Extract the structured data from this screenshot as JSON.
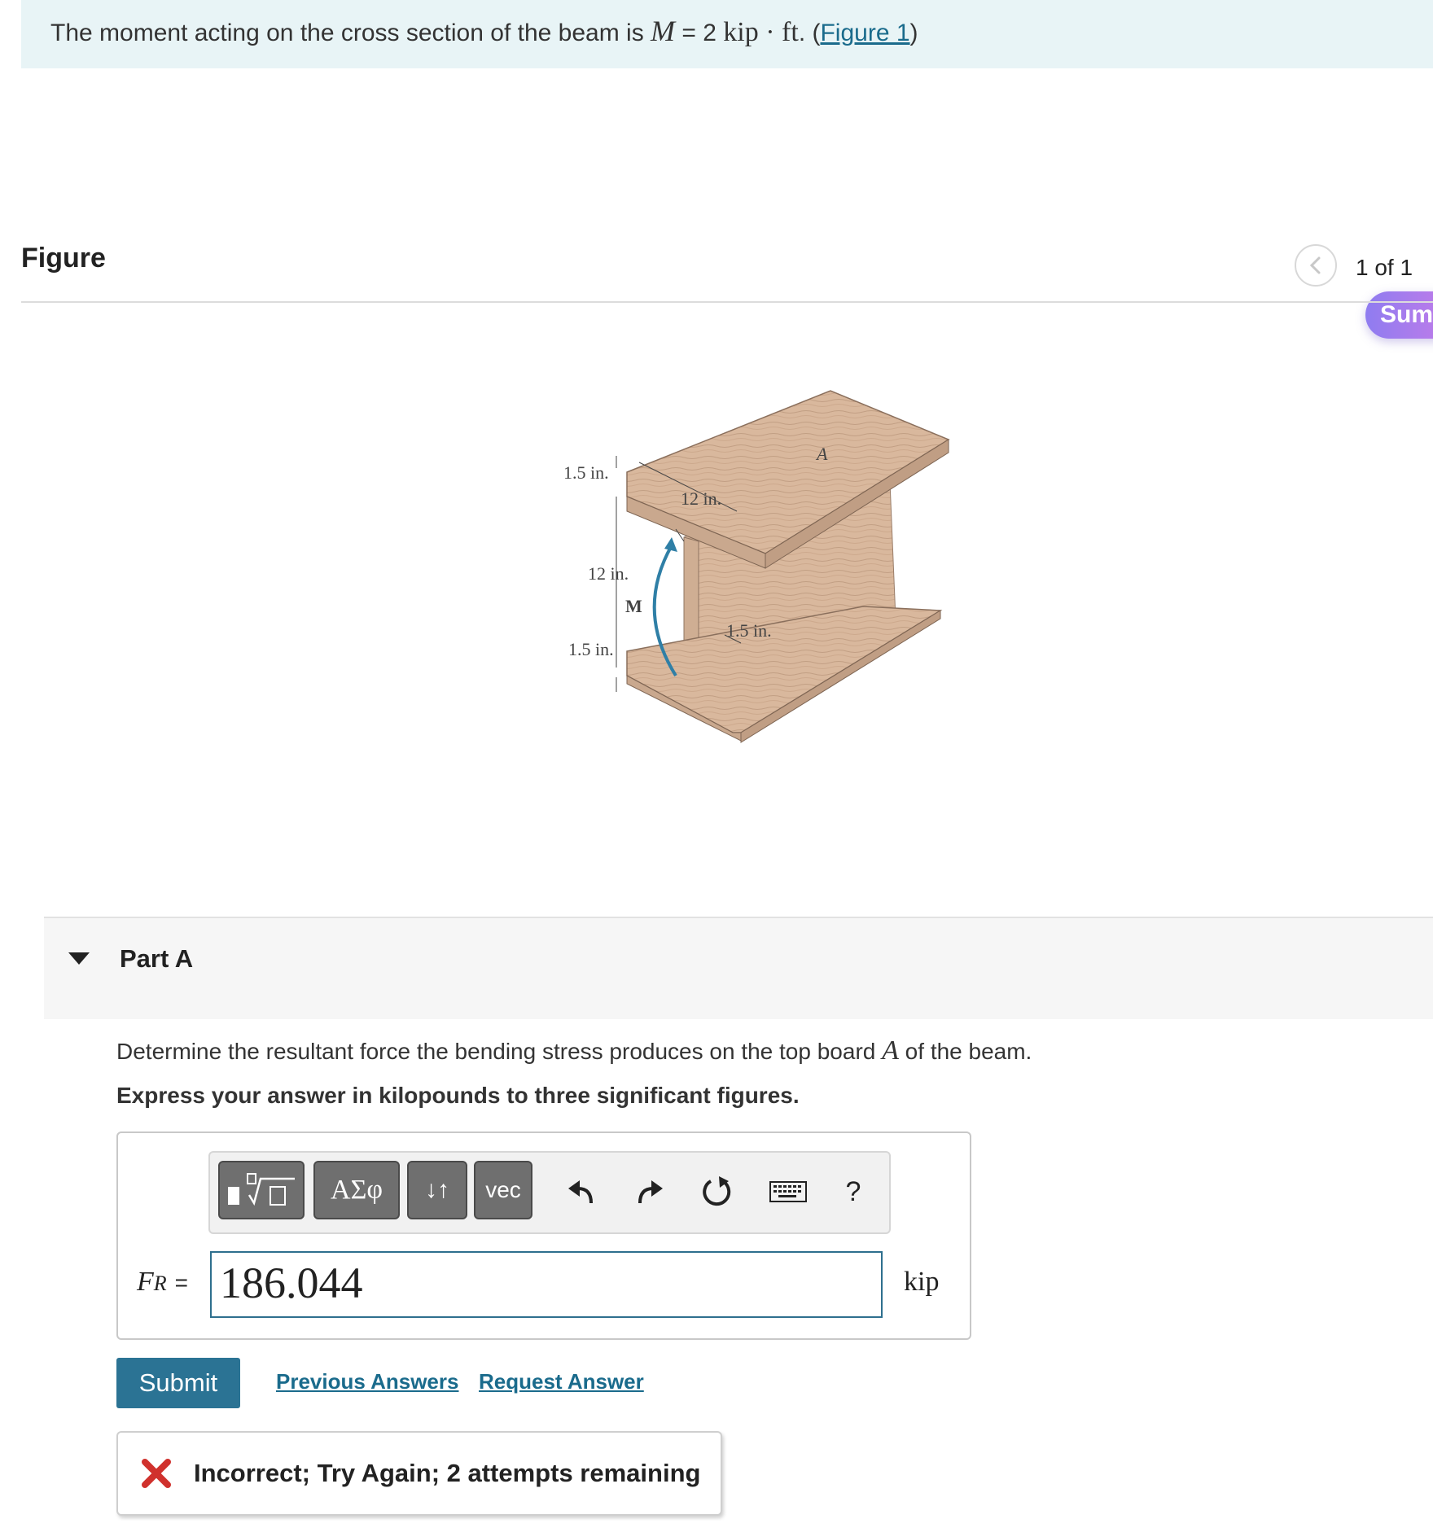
{
  "problem": {
    "text_before": "The moment acting on the cross section of the beam is ",
    "symbol": "M",
    "equals": " = 2 ",
    "unit": "kip · ft",
    "after_unit": ". (",
    "figure_link": "Figure 1",
    "close": ")"
  },
  "figure_panel": {
    "title": "Figure",
    "count": "1 of 1",
    "summary_pill": "Sum",
    "labels": {
      "top_flange_thickness": "1.5 in.",
      "flange_width": "12 in.",
      "web_depth": "12 in.",
      "moment": "M",
      "web_thickness": "1.5 in.",
      "bottom_flange_thickness": "1.5 in.",
      "board": "A"
    }
  },
  "part_a": {
    "title": "Part A",
    "question_before": "Determine the resultant force the bending stress produces on the top board ",
    "question_symbol": "A",
    "question_after": " of the beam.",
    "instruction": "Express your answer in kilopounds to three significant figures.",
    "toolbar": {
      "templates": "",
      "greek": "ΑΣφ",
      "arrows": "↓↑",
      "vec": "vec",
      "help": "?"
    },
    "answer_label": "F",
    "answer_label_sub": "R",
    "answer_equals": "=",
    "answer_value": "186.044",
    "unit": "kip",
    "submit": "Submit",
    "previous_answers": "Previous Answers",
    "request_answer": "Request Answer",
    "feedback": "Incorrect; Try Again; 2 attempts remaining"
  },
  "colors": {
    "banner_bg": "#e8f4f6",
    "link": "#1a6b8c",
    "submit_bg": "#2b7394",
    "error": "#d0312d",
    "moment_arrow": "#2f7fa6",
    "wood": "#d8b79c"
  }
}
